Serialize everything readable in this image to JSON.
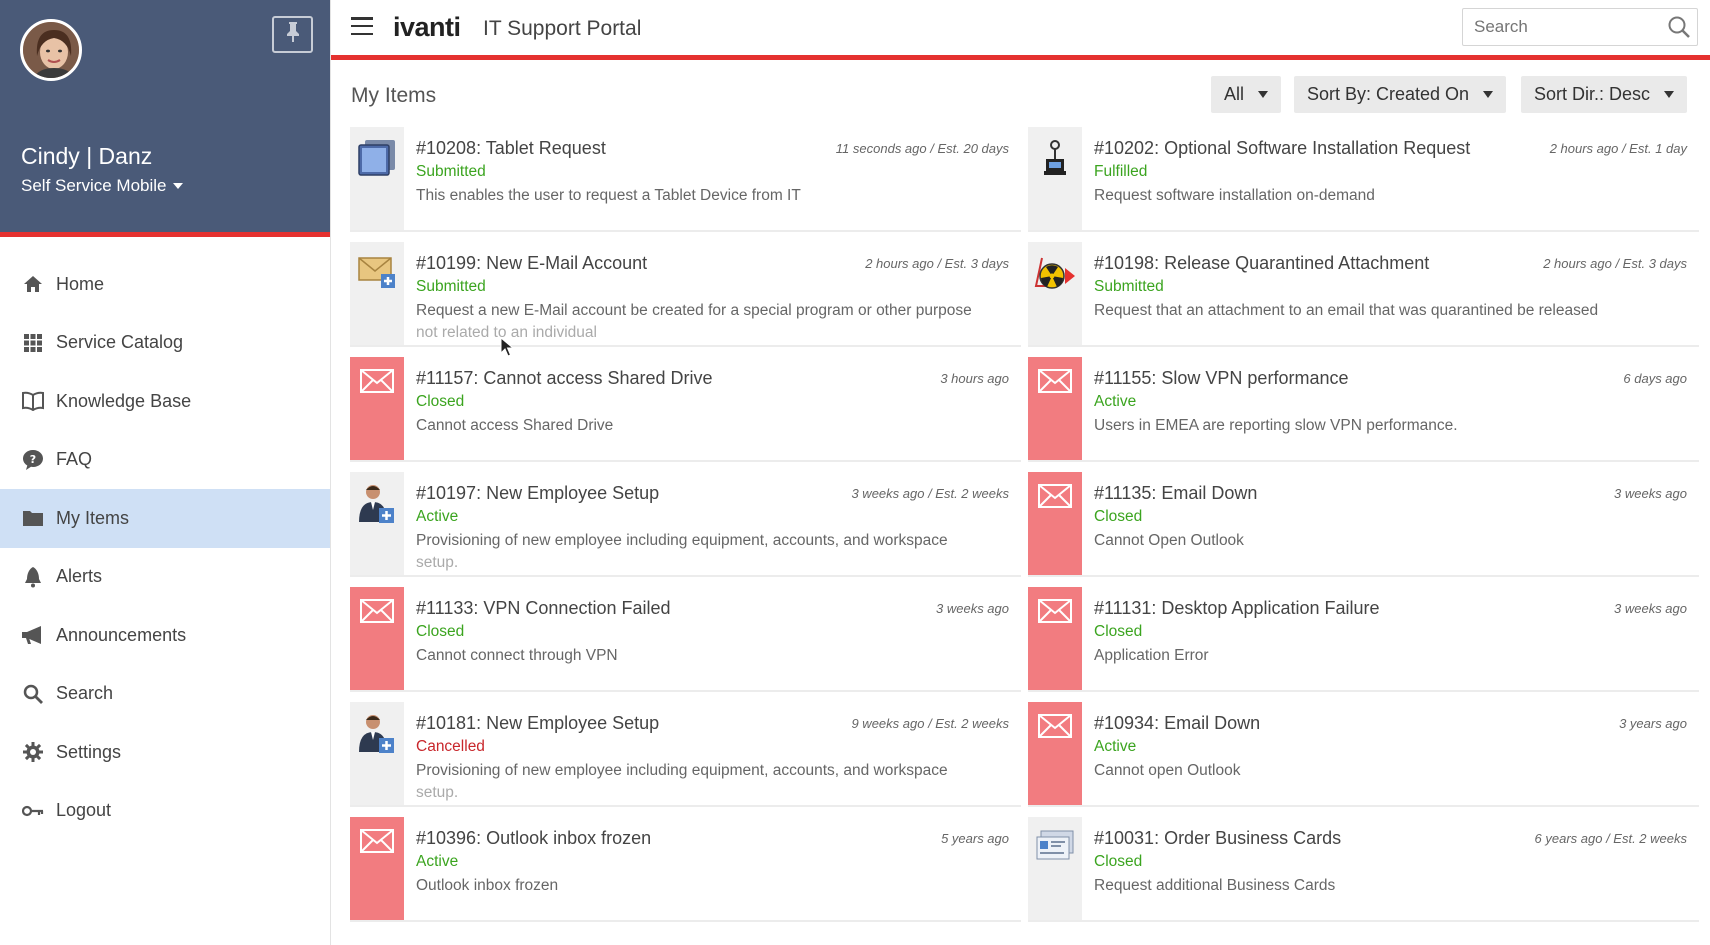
{
  "app": {
    "logo_text": "ivanti",
    "portal_title": "IT Support Portal",
    "accent_color": "#e5312f"
  },
  "user": {
    "name": "Cindy | Danz",
    "role": "Self Service Mobile"
  },
  "nav": [
    {
      "label": "Home",
      "icon": "home-icon"
    },
    {
      "label": "Service Catalog",
      "icon": "grid-icon"
    },
    {
      "label": "Knowledge Base",
      "icon": "book-icon"
    },
    {
      "label": "FAQ",
      "icon": "speech-bubble-icon"
    },
    {
      "label": "My Items",
      "icon": "folder-icon",
      "active": true
    },
    {
      "label": "Alerts",
      "icon": "bell-icon"
    },
    {
      "label": "Announcements",
      "icon": "megaphone-icon"
    },
    {
      "label": "Search",
      "icon": "search-icon"
    },
    {
      "label": "Settings",
      "icon": "gear-icon"
    },
    {
      "label": "Logout",
      "icon": "key-icon"
    }
  ],
  "search": {
    "placeholder": "Search"
  },
  "content": {
    "title": "My Items",
    "filter_label": "All",
    "sort_by_label": "Sort By: Created On",
    "sort_dir_label": "Sort Dir.: Desc"
  },
  "items": [
    {
      "title": "#10208: Tablet Request",
      "time": "11 seconds ago / Est. 20 days",
      "status": "Submitted",
      "status_color": "green",
      "desc": "This enables the user to request a Tablet Device from IT",
      "desc_fade": "",
      "icon": "tablet-icon"
    },
    {
      "title": "#10202: Optional Software Installation Request",
      "time": "2 hours ago / Est. 1 day",
      "status": "Fulfilled",
      "status_color": "green",
      "desc": "Request software installation on-demand",
      "desc_fade": "",
      "icon": "software-install-icon"
    },
    {
      "title": "#10199: New E-Mail Account",
      "time": "2 hours ago / Est. 3 days",
      "status": "Submitted",
      "status_color": "green",
      "desc": "Request a new E-Mail account be created for a special program or other purpose",
      "desc_fade": "not related to an individual",
      "icon": "new-email-icon"
    },
    {
      "title": "#10198: Release Quarantined Attachment",
      "time": "2 hours ago / Est. 3 days",
      "status": "Submitted",
      "status_color": "green",
      "desc": "Request that an attachment to an email that was quarantined be released",
      "desc_fade": "",
      "icon": "quarantine-icon"
    },
    {
      "title": "#11157: Cannot access Shared Drive",
      "time": "3 hours ago",
      "status": "Closed",
      "status_color": "green",
      "desc": "Cannot access Shared Drive",
      "desc_fade": "",
      "icon": "mail-icon"
    },
    {
      "title": "#11155: Slow VPN performance",
      "time": "6 days ago",
      "status": "Active",
      "status_color": "green",
      "desc": "Users in EMEA are reporting slow VPN performance.",
      "desc_fade": "",
      "icon": "mail-icon"
    },
    {
      "title": "#10197: New Employee Setup",
      "time": "3 weeks ago / Est. 2 weeks",
      "status": "Active",
      "status_color": "green",
      "desc": "Provisioning of new employee including equipment, accounts, and workspace",
      "desc_fade": "setup.",
      "icon": "new-employee-icon"
    },
    {
      "title": "#11135: Email Down",
      "time": "3 weeks ago",
      "status": "Closed",
      "status_color": "green",
      "desc": "Cannot Open Outlook",
      "desc_fade": "",
      "icon": "mail-icon"
    },
    {
      "title": "#11133: VPN Connection Failed",
      "time": "3 weeks ago",
      "status": "Closed",
      "status_color": "green",
      "desc": "Cannot connect through VPN",
      "desc_fade": "",
      "icon": "mail-icon"
    },
    {
      "title": "#11131: Desktop Application Failure",
      "time": "3 weeks ago",
      "status": "Closed",
      "status_color": "green",
      "desc": "Application Error",
      "desc_fade": "",
      "icon": "mail-icon"
    },
    {
      "title": "#10181: New Employee Setup",
      "time": "9 weeks ago / Est. 2 weeks",
      "status": "Cancelled",
      "status_color": "red",
      "desc": "Provisioning of new employee including equipment, accounts, and workspace",
      "desc_fade": "setup.",
      "icon": "new-employee-icon"
    },
    {
      "title": "#10934: Email Down",
      "time": "3 years ago",
      "status": "Active",
      "status_color": "green",
      "desc": "Cannot open Outlook",
      "desc_fade": "",
      "icon": "mail-icon"
    },
    {
      "title": "#10396: Outlook inbox frozen",
      "time": "5 years ago",
      "status": "Active",
      "status_color": "green",
      "desc": "Outlook inbox frozen",
      "desc_fade": "",
      "icon": "mail-icon"
    },
    {
      "title": "#10031: Order Business Cards",
      "time": "6 years ago / Est. 2 weeks",
      "status": "Closed",
      "status_color": "green",
      "desc": "Request additional Business Cards",
      "desc_fade": "",
      "icon": "business-card-icon"
    }
  ]
}
